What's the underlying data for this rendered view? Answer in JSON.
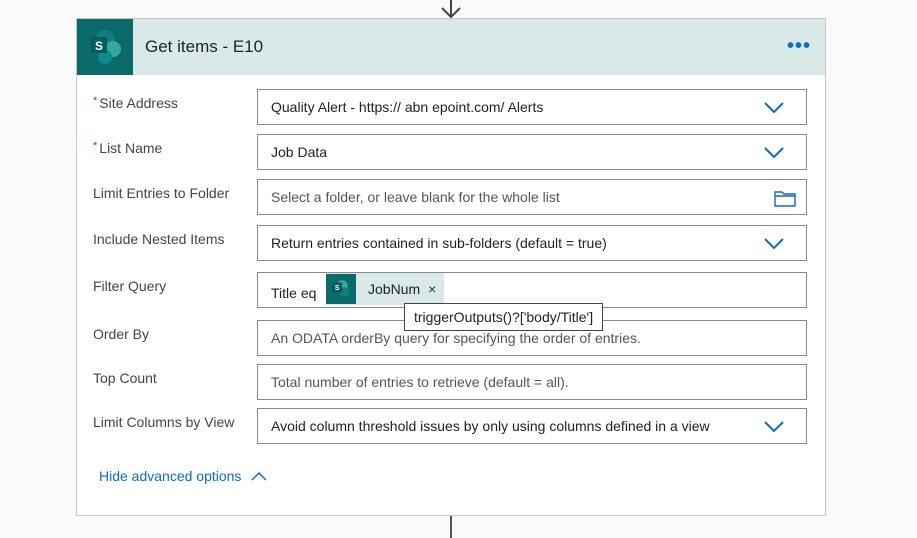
{
  "card": {
    "title": "Get items - E10",
    "menu_icon": "more-ellipsis-icon",
    "accent": "#0b6a6a",
    "header_bg": "#d9e8e8"
  },
  "fields": [
    {
      "label": "Site Address",
      "required": true,
      "value": "Quality Alert - https://          abn          epoint.com/  Alerts"
    },
    {
      "label": "List Name",
      "required": true,
      "value": "Job Data"
    },
    {
      "label": "Limit Entries to Folder",
      "placeholder": "Select a folder, or leave blank for the whole list"
    },
    {
      "label": "Include Nested Items",
      "value": "Return entries contained in sub-folders (default = true)"
    },
    {
      "label": "Filter Query",
      "prefix": "Title eq",
      "token": "JobNum",
      "token_close": "×"
    },
    {
      "label": "Order By",
      "placeholder": "An ODATA orderBy query for specifying the order of entries."
    },
    {
      "label": "Top Count",
      "placeholder": "Total number of entries to retrieve (default = all)."
    },
    {
      "label": "Limit Columns by View",
      "value": "Avoid column threshold issues by only using columns defined in a view"
    }
  ],
  "tooltip": "triggerOutputs()?['body/Title']",
  "advanced_toggle": "Hide advanced options",
  "required_mark": "*",
  "logo_letter": "S"
}
